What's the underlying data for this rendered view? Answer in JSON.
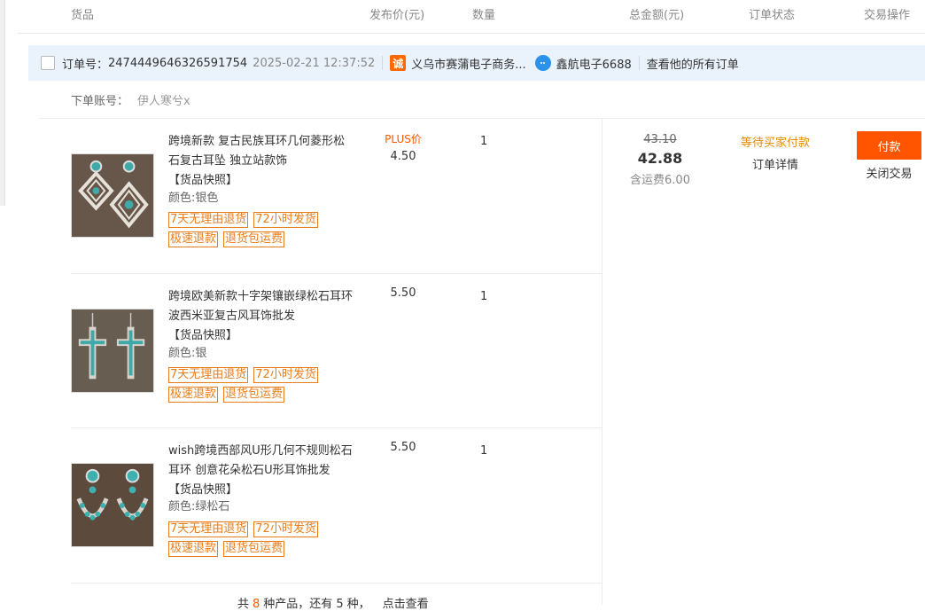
{
  "header": {
    "goods": "货品",
    "price": "发布价(元)",
    "quantity": "数量",
    "total": "总金额(元)",
    "status": "订单状态",
    "action": "交易操作"
  },
  "order": {
    "number_label": "订单号：",
    "number": "2474449646326591754",
    "time": "2025-02-21 12:37:52",
    "shop_icon": "shop-icon",
    "shop": "义乌市赛蒲电子商务...",
    "seller_icon": "chat-icon",
    "seller": "鑫航电子6688",
    "view_all": "查看他的所有订单"
  },
  "account": {
    "label": "下单账号：",
    "name": "伊人寒兮x"
  },
  "products": [
    {
      "title": "跨境新款 复古民族耳环几何菱形松石复古耳坠 独立站款饰",
      "snapshot": "【货品快照】",
      "sku": "颜色:银色",
      "tags": [
        "7天无理由退货",
        "72小时发货",
        "极速退款",
        "退货包运费"
      ],
      "price_badge": "PLUS价",
      "price": "4.50",
      "qty": "1"
    },
    {
      "title": "跨境欧美新款十字架镶嵌绿松石耳环 波西米亚复古风耳饰批发",
      "snapshot": "【货品快照】",
      "sku": "颜色:银",
      "tags": [
        "7天无理由退货",
        "72小时发货",
        "极速退款",
        "退货包运费"
      ],
      "price": "5.50",
      "qty": "1"
    },
    {
      "title": "wish跨境西部风U形几何不规则松石耳环 创意花朵松石U形耳饰批发",
      "snapshot": "【货品快照】",
      "sku": "颜色:绿松石",
      "tags": [
        "7天无理由退货",
        "72小时发货",
        "极速退款",
        "退货包运费"
      ],
      "price": "5.50",
      "qty": "1"
    }
  ],
  "total": {
    "original": "43.10",
    "final": "42.88",
    "shipping": "含运费6.00"
  },
  "status": {
    "text": "等待买家付款",
    "detail": "订单详情"
  },
  "actions": {
    "pay": "付款",
    "close": "关闭交易"
  },
  "more": {
    "prefix": "共",
    "count": "8",
    "middle": "种产品，还有",
    "remaining": "5",
    "suffix": "种，",
    "link": "点击查看"
  },
  "colors": {
    "accent": "#ff5500",
    "status": "#e58a00",
    "tag": "#e87d1c",
    "order_bar": "#eaf2fc"
  }
}
